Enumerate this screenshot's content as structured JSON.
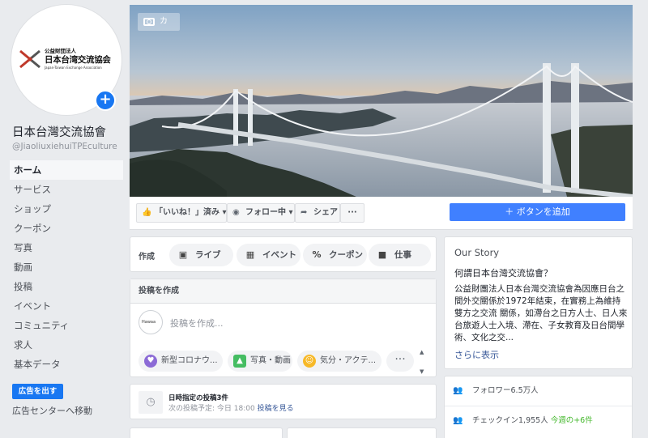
{
  "page": {
    "title": "日本台灣交流協會",
    "handle": "@JiaoliuxiehuiTPEculture"
  },
  "logo": {
    "small_text": "公益財団法人",
    "main_text": "日本台湾交流協会",
    "english_text": "Japan-Taiwan Exchange Association"
  },
  "sidebar": {
    "items": [
      {
        "label": "ホーム",
        "active": true
      },
      {
        "label": "サービス"
      },
      {
        "label": "ショップ"
      },
      {
        "label": "クーポン"
      },
      {
        "label": "写真"
      },
      {
        "label": "動画"
      },
      {
        "label": "投稿"
      },
      {
        "label": "イベント"
      },
      {
        "label": "コミュニティ"
      },
      {
        "label": "求人"
      },
      {
        "label": "基本データ"
      }
    ],
    "ad_button": "広告を出す",
    "ad_center_link": "広告センターへ移動"
  },
  "cover": {
    "camera_label": "カ"
  },
  "action_bar": {
    "like": "「いいね！」済み",
    "follow": "フォロー中",
    "share": "シェア",
    "more": "···",
    "add_button": "＋ ボタンを追加"
  },
  "create": {
    "label": "作成",
    "live": "ライブ",
    "event": "イベント",
    "coupon": "クーポン",
    "job": "仕事"
  },
  "compose": {
    "heading": "投稿を作成",
    "avatar_text": "Hawaa",
    "placeholder": "投稿を作成...",
    "chip_covid": "新型コロナウ...",
    "chip_photo": "写真・動画",
    "chip_feeling": "気分・アクテ...",
    "more": "···"
  },
  "scheduled": {
    "title": "日時指定の投稿3件",
    "sub_prefix": "次の投稿予定: 今日 18:00 ",
    "sub_link": "投稿を見る"
  },
  "story": {
    "title": "Our Story",
    "question": "何謂日本台灣交流協會？",
    "body": "公益財團法人日本台灣交流協會為因應日台之間外交關係於1972年結束，在實務上為維持雙方之交流 關係，如滯台之日方人士、日人來台旅遊人士入境、滯在、子女教育及日台間學術、文化之交...",
    "more_link": "さらに表示"
  },
  "info": {
    "followers": "フォロワー6.5万人",
    "checkins_prefix": "チェックイン1,955人 ",
    "checkins_week": "今週の+6件"
  },
  "colors": {
    "brand_blue": "#1877f2",
    "button_blue": "#4080ff",
    "link": "#385898",
    "green": "#42b72a"
  }
}
